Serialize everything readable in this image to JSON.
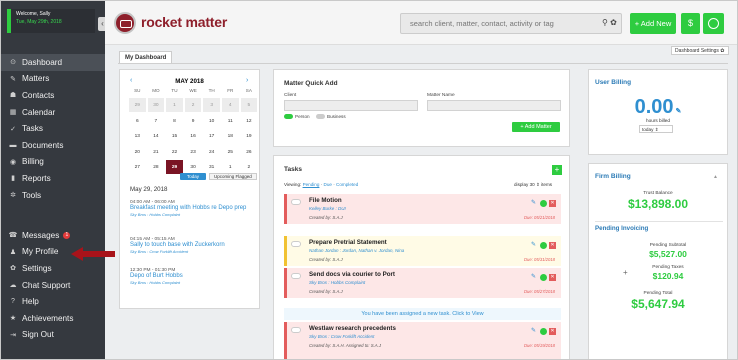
{
  "welcome": {
    "line1": "Welcome, Sally",
    "line2": "Tue, May 29th, 2018"
  },
  "sidebar": {
    "main": [
      {
        "label": "Dashboard",
        "icon": "⊙",
        "active": true
      },
      {
        "label": "Matters",
        "icon": "✎"
      },
      {
        "label": "Contacts",
        "icon": "☗"
      },
      {
        "label": "Calendar",
        "icon": "▦"
      },
      {
        "label": "Tasks",
        "icon": "✓"
      },
      {
        "label": "Documents",
        "icon": "▬"
      },
      {
        "label": "Billing",
        "icon": "◉"
      },
      {
        "label": "Reports",
        "icon": "▮"
      },
      {
        "label": "Tools",
        "icon": "✲"
      }
    ],
    "bottom": [
      {
        "label": "Messages",
        "icon": "☎",
        "badge": "1"
      },
      {
        "label": "My Profile",
        "icon": "♟"
      },
      {
        "label": "Settings",
        "icon": "✿"
      },
      {
        "label": "Chat Support",
        "icon": "☁"
      },
      {
        "label": "Help",
        "icon": "?"
      },
      {
        "label": "Achievements",
        "icon": "★"
      },
      {
        "label": "Sign Out",
        "icon": "⇥"
      }
    ]
  },
  "header": {
    "brand": "rocket matter",
    "search_placeholder": "search client, matter, contact, activity or tag",
    "add_new": "+ Add New",
    "dollar": "$"
  },
  "dashboard": {
    "tab": "My Dashboard",
    "settings": "Dashboard Settings ✿"
  },
  "calendar": {
    "month": "MAY 2018",
    "prev": "‹",
    "next": "›",
    "dow": [
      "SU",
      "MO",
      "TU",
      "WE",
      "TH",
      "FR",
      "SA"
    ],
    "days": [
      {
        "d": "29",
        "m": 1
      },
      {
        "d": "30",
        "m": 1
      },
      {
        "d": "1",
        "m": 1
      },
      {
        "d": "2",
        "m": 1
      },
      {
        "d": "3",
        "m": 1
      },
      {
        "d": "4",
        "m": 1
      },
      {
        "d": "5",
        "m": 1
      },
      {
        "d": "6"
      },
      {
        "d": "7"
      },
      {
        "d": "8"
      },
      {
        "d": "9"
      },
      {
        "d": "10"
      },
      {
        "d": "11"
      },
      {
        "d": "12"
      },
      {
        "d": "13"
      },
      {
        "d": "14"
      },
      {
        "d": "15"
      },
      {
        "d": "16"
      },
      {
        "d": "17"
      },
      {
        "d": "18"
      },
      {
        "d": "19"
      },
      {
        "d": "20"
      },
      {
        "d": "21"
      },
      {
        "d": "22"
      },
      {
        "d": "23"
      },
      {
        "d": "24"
      },
      {
        "d": "25"
      },
      {
        "d": "26"
      },
      {
        "d": "27"
      },
      {
        "d": "28"
      },
      {
        "d": "29",
        "t": 1
      },
      {
        "d": "30"
      },
      {
        "d": "31"
      },
      {
        "d": "1"
      },
      {
        "d": "2"
      }
    ],
    "today_btn": "Today",
    "upcoming_btn": "Upcoming Flagged",
    "date_label": "May 29, 2018",
    "events": [
      {
        "time": "04:00 AM - 06:00 AM",
        "name": "Breakfast meeting with Hobbs re Depo prep",
        "sub": "Sky Bros : Hobbs Complaint"
      },
      {
        "time": "04:15 AM - 05:15 AM",
        "name": "Sally to touch base with Zuckerkorn",
        "sub": "Sky Bros : Crow Forklift Accident"
      },
      {
        "time": "12:30 PM - 01:30 PM",
        "name": "Depo of Burt Hobbs",
        "sub": "Sky Bros : Hobbs Complaint"
      }
    ]
  },
  "quick_add": {
    "title": "Matter Quick Add",
    "client_label": "Client",
    "matter_label": "Matter Name",
    "person": "Person",
    "business": "Business",
    "add_btn": "+ Add Matter"
  },
  "tasks": {
    "title": "Tasks",
    "add": "+",
    "viewing_label": "Viewing:",
    "viewing_pending": "Pending",
    "viewing_due": "Due",
    "viewing_completed": "Completed",
    "display": "display  30 ⇕  items",
    "items": [
      {
        "name": "File Motion",
        "sub": "Kelley Burke : DUI",
        "by": "Created by: S.A.J",
        "due": "Due: 05/21/2018",
        "color": "red"
      },
      {
        "name": "Prepare Pretrial Statement",
        "sub": "Nathan Jordan : Jordan, Nathan v. Jordan, Nina",
        "by": "Created by: S.A.J",
        "due": "Due: 05/31/2018",
        "color": "yellow"
      },
      {
        "name": "Send docs via courier to Port",
        "sub": "Sky Bros : Hobbs Complaint",
        "by": "Created by: S.A.J",
        "due": "Due: 05/27/2018",
        "color": "red"
      },
      {
        "name": "Westlaw research precedents",
        "sub": "Sky Bros : Crow Forklift Accident",
        "by": "Created by: S.A.H. Assigned to: S.A.J",
        "due": "Due: 05/19/2018",
        "color": "red"
      }
    ],
    "assigned_notice": "You have been assigned a new task. Click to View"
  },
  "user_billing": {
    "title": "User Billing",
    "hours": "0.00",
    "hours_label": "hours billed",
    "period": "today ⇕"
  },
  "firm_billing": {
    "title": "Firm Billing",
    "trust_label": "Trust Balance",
    "trust": "$13,898.00",
    "pending_title": "Pending Invoicing",
    "subtotal_label": "Pending Subtotal",
    "subtotal": "$5,527.00",
    "taxes_label": "Pending Taxes",
    "taxes": "$120.94",
    "total_label": "Pending Total",
    "total": "$5,647.94"
  },
  "colors": {
    "accent_green": "#2ecc40",
    "brand_red": "#8e1f2b",
    "link_blue": "#2f8fd0"
  }
}
